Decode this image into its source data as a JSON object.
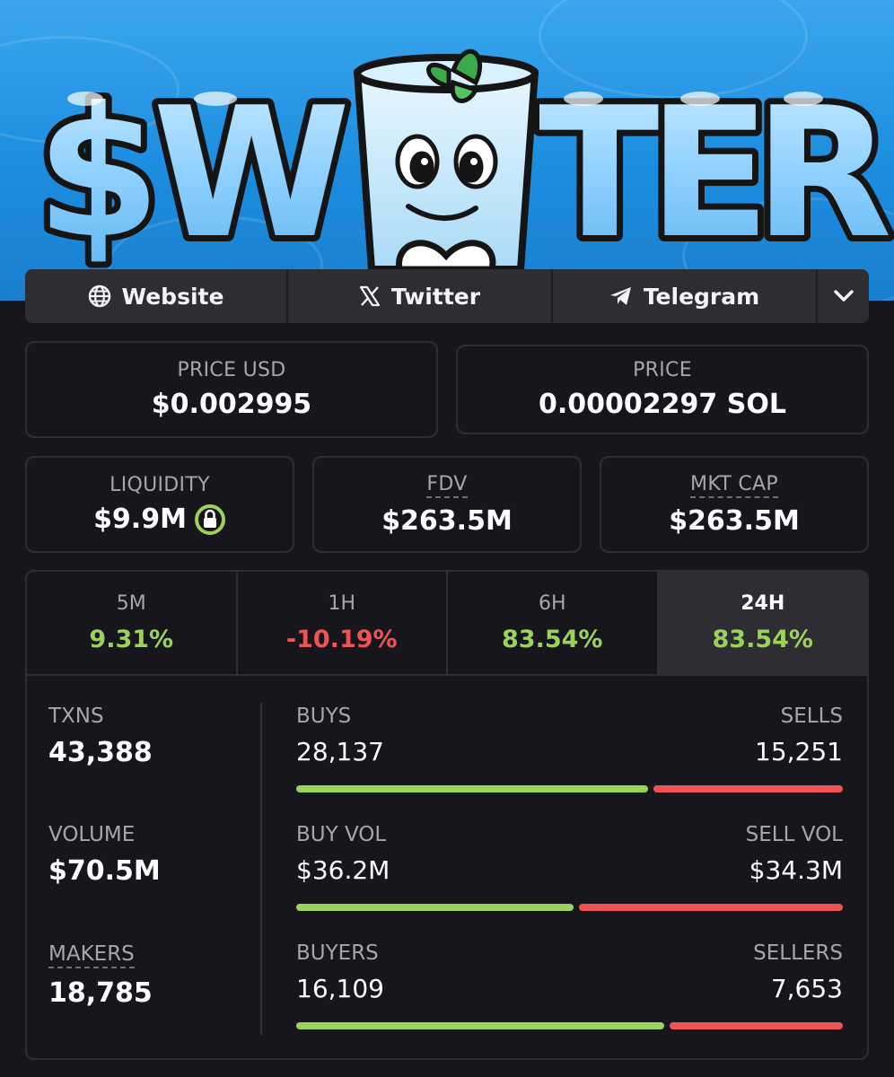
{
  "banner": {
    "logo_text": "$WATER",
    "colors": {
      "sky": "#2a97e6",
      "letters": "#8fd0ff",
      "outline": "#151515"
    }
  },
  "links": {
    "website": "Website",
    "twitter": "Twitter",
    "telegram": "Telegram"
  },
  "price": {
    "usd_label": "PRICE USD",
    "usd_value": "$0.002995",
    "native_label": "PRICE",
    "native_value": "0.00002297 SOL"
  },
  "metrics": {
    "liquidity_label": "LIQUIDITY",
    "liquidity_value": "$9.9M",
    "fdv_label": "FDV",
    "fdv_value": "$263.5M",
    "mcap_label": "MKT CAP",
    "mcap_value": "$263.5M"
  },
  "timeframes": [
    {
      "label": "5M",
      "change": "9.31%",
      "direction": "up"
    },
    {
      "label": "1H",
      "change": "-10.19%",
      "direction": "down"
    },
    {
      "label": "6H",
      "change": "83.54%",
      "direction": "up"
    },
    {
      "label": "24H",
      "change": "83.54%",
      "direction": "up",
      "selected": true
    }
  ],
  "totals": {
    "txns_label": "TXNS",
    "txns_value": "43,388",
    "volume_label": "VOLUME",
    "volume_value": "$70.5M",
    "makers_label": "MAKERS",
    "makers_value": "18,785"
  },
  "splits": [
    {
      "left_label": "BUYS",
      "left_value": "28,137",
      "right_label": "SELLS",
      "right_value": "15,251",
      "buy_fraction": 0.648
    },
    {
      "left_label": "BUY VOL",
      "left_value": "$36.2M",
      "right_label": "SELL VOL",
      "right_value": "$34.3M",
      "buy_fraction": 0.513
    },
    {
      "left_label": "BUYERS",
      "left_value": "16,109",
      "right_label": "SELLERS",
      "right_value": "7,653",
      "buy_fraction": 0.678
    }
  ],
  "colors": {
    "positive": "#9ad25c",
    "negative": "#ef5454",
    "lock_ring": "#9ad25c"
  }
}
